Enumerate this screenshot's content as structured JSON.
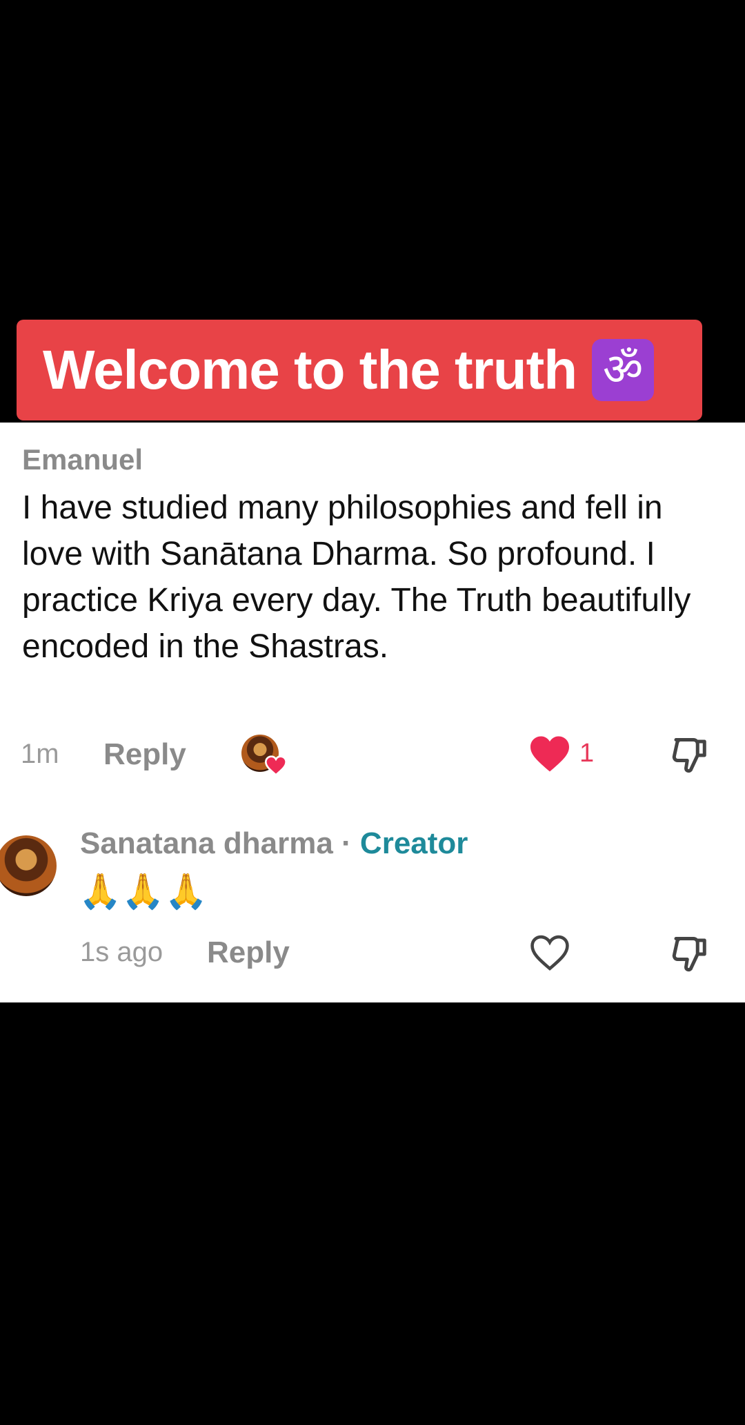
{
  "banner": {
    "title": "Welcome to the truth",
    "om_symbol": "ॐ",
    "colors": {
      "background": "#e84347",
      "om_badge": "#9b3fd2"
    }
  },
  "comment": {
    "username": "Emanuel",
    "text": "I have studied many philosophies and fell in love with Sanātana Dharma. So profound. I practice Kriya every day. The Truth beautifully encoded in the Shastras.",
    "time": "1m",
    "reply_label": "Reply",
    "liked_by_creator": true,
    "like_count": "1",
    "liked": true,
    "icons": {
      "like": "heart-filled-icon",
      "dislike": "thumbs-down-icon"
    }
  },
  "reply": {
    "username": "Sanatana dharma",
    "separator": " · ",
    "badge": "Creator",
    "text": "🙏🙏🙏",
    "time": "1s ago",
    "reply_label": "Reply",
    "liked": false,
    "icons": {
      "like": "heart-outline-icon",
      "dislike": "thumbs-down-icon"
    }
  },
  "colors": {
    "creator_tag": "#1e8a9a",
    "like_active": "#e8385a"
  }
}
